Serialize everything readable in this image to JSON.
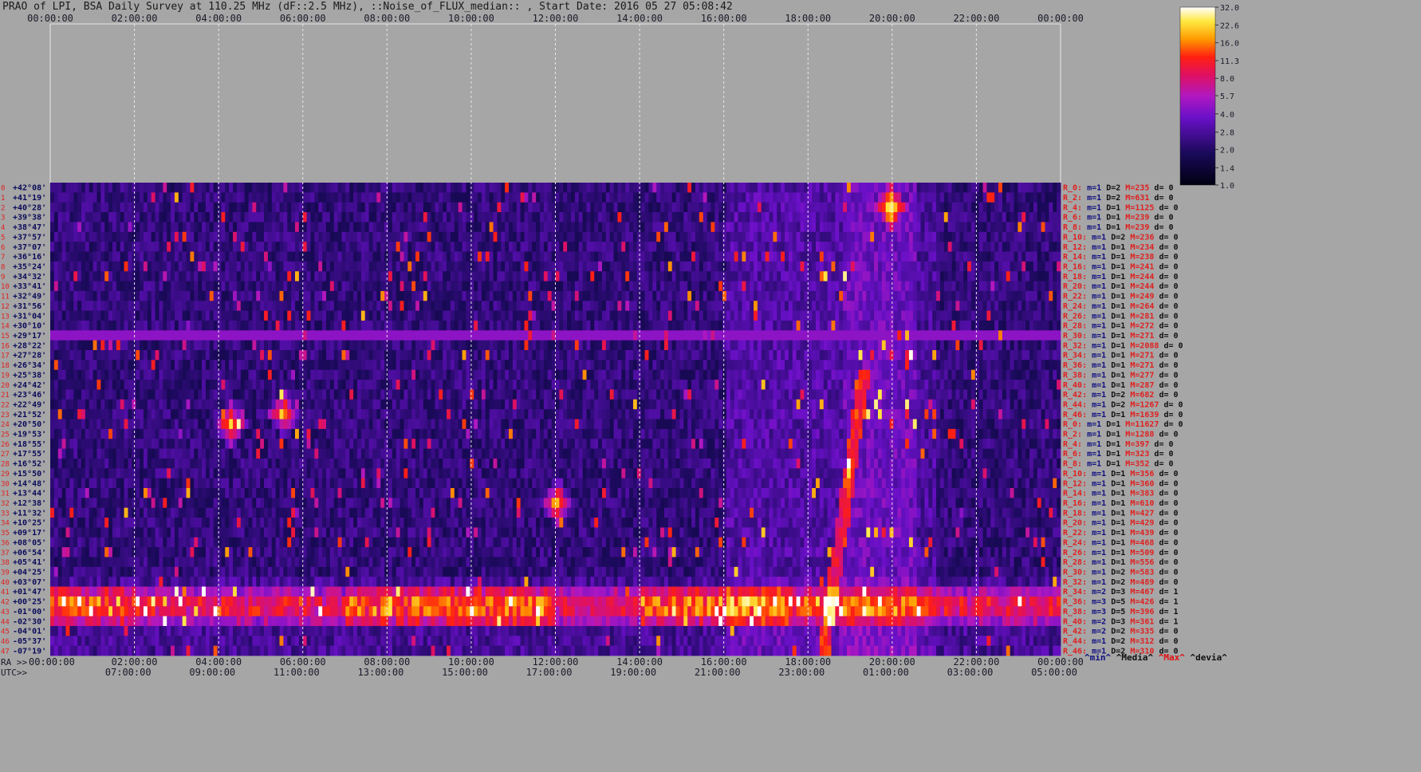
{
  "title": "PRAO of LPI, BSA Daily Survey at 110.25 MHz (dF::2.5 MHz), ::Noise_of_FLUX_median:: , Start Date: 2016 05 27 05:08:42",
  "chart_data": {
    "type": "heatmap",
    "title": "PRAO of LPI, BSA Daily Survey at 110.25 MHz (dF::2.5 MHz), ::Noise_of_FLUX_median:: , Start Date: 2016 05 27 05:08:42",
    "top_axis_ticks": [
      "00:00:00",
      "02:00:00",
      "04:00:00",
      "06:00:00",
      "08:00:00",
      "10:00:00",
      "12:00:00",
      "14:00:00",
      "16:00:00",
      "18:00:00",
      "20:00:00",
      "22:00:00",
      "00:00:00"
    ],
    "ra_axis_label": "RA >>",
    "ra_ticks": [
      "00:00:00",
      "02:00:00",
      "04:00:00",
      "06:00:00",
      "08:00:00",
      "10:00:00",
      "12:00:00",
      "14:00:00",
      "16:00:00",
      "18:00:00",
      "20:00:00",
      "22:00:00",
      "00:00:00"
    ],
    "utc_axis_label": "UTC>>",
    "utc_ticks": [
      "07:00:00",
      "09:00:00",
      "11:00:00",
      "13:00:00",
      "15:00:00",
      "17:00:00",
      "19:00:00",
      "21:00:00",
      "23:00:00",
      "01:00:00",
      "03:00:00",
      "05:00:00"
    ],
    "declinations": [
      "+42°08'",
      "+41°19'",
      "+40°28'",
      "+39°38'",
      "+38°47'",
      "+37°57'",
      "+37°07'",
      "+36°16'",
      "+35°24'",
      "+34°32'",
      "+33°41'",
      "+32°49'",
      "+31°56'",
      "+31°04'",
      "+30°10'",
      "+29°17'",
      "+28°22'",
      "+27°28'",
      "+26°34'",
      "+25°38'",
      "+24°42'",
      "+23°46'",
      "+22°49'",
      "+21°52'",
      "+20°50'",
      "+19°53'",
      "+18°55'",
      "+17°55'",
      "+16°52'",
      "+15°50'",
      "+14°48'",
      "+13°44'",
      "+12°38'",
      "+11°32'",
      "+10°25'",
      "+09°17'",
      "+08°05'",
      "+06°54'",
      "+05°41'",
      "+04°25'",
      "+03°07'",
      "+01°47'",
      "+00°25'",
      "-01°00'",
      "-02°30'",
      "-04°01'",
      "-05°37'",
      "-07°19'"
    ],
    "row_indices": [
      "0",
      "1",
      "2",
      "3",
      "4",
      "5",
      "6",
      "7",
      "8",
      "9",
      "10",
      "11",
      "12",
      "13",
      "14",
      "15",
      "16",
      "17",
      "18",
      "19",
      "20",
      "21",
      "22",
      "23",
      "24",
      "25",
      "26",
      "27",
      "28",
      "29",
      "30",
      "31",
      "32",
      "33",
      "34",
      "35",
      "36",
      "37",
      "38",
      "39",
      "40",
      "41",
      "42",
      "43",
      "44",
      "45",
      "46",
      "47"
    ],
    "row_stats": [
      {
        "r": "R_0:",
        "m": "m=1",
        "d": "D=2",
        "M": "M=235",
        "dv": "d= 0"
      },
      {
        "r": "R_2:",
        "m": "m=1",
        "d": "D=2",
        "M": "M=631",
        "dv": "d= 0"
      },
      {
        "r": "R_4:",
        "m": "m=1",
        "d": "D=1",
        "M": "M=1125",
        "dv": "d= 0"
      },
      {
        "r": "R_6:",
        "m": "m=1",
        "d": "D=1",
        "M": "M=239",
        "dv": "d= 0"
      },
      {
        "r": "R_8:",
        "m": "m=1",
        "d": "D=1",
        "M": "M=239",
        "dv": "d= 0"
      },
      {
        "r": "R_10:",
        "m": "m=1",
        "d": "D=2",
        "M": "M=236",
        "dv": "d= 0"
      },
      {
        "r": "R_12:",
        "m": "m=1",
        "d": "D=1",
        "M": "M=234",
        "dv": "d= 0"
      },
      {
        "r": "R_14:",
        "m": "m=1",
        "d": "D=1",
        "M": "M=238",
        "dv": "d= 0"
      },
      {
        "r": "R_16:",
        "m": "m=1",
        "d": "D=1",
        "M": "M=241",
        "dv": "d= 0"
      },
      {
        "r": "R_18:",
        "m": "m=1",
        "d": "D=1",
        "M": "M=244",
        "dv": "d= 0"
      },
      {
        "r": "R_20:",
        "m": "m=1",
        "d": "D=1",
        "M": "M=244",
        "dv": "d= 0"
      },
      {
        "r": "R_22:",
        "m": "m=1",
        "d": "D=1",
        "M": "M=249",
        "dv": "d= 0"
      },
      {
        "r": "R_24:",
        "m": "m=1",
        "d": "D=1",
        "M": "M=264",
        "dv": "d= 0"
      },
      {
        "r": "R_26:",
        "m": "m=1",
        "d": "D=1",
        "M": "M=281",
        "dv": "d= 0"
      },
      {
        "r": "R_28:",
        "m": "m=1",
        "d": "D=1",
        "M": "M=272",
        "dv": "d= 0"
      },
      {
        "r": "R_30:",
        "m": "m=1",
        "d": "D=1",
        "M": "M=271",
        "dv": "d= 0"
      },
      {
        "r": "R_32:",
        "m": "m=1",
        "d": "D=1",
        "M": "M=2088",
        "dv": "d= 0"
      },
      {
        "r": "R_34:",
        "m": "m=1",
        "d": "D=1",
        "M": "M=271",
        "dv": "d= 0"
      },
      {
        "r": "R_36:",
        "m": "m=1",
        "d": "D=1",
        "M": "M=271",
        "dv": "d= 0"
      },
      {
        "r": "R_38:",
        "m": "m=1",
        "d": "D=1",
        "M": "M=277",
        "dv": "d= 0"
      },
      {
        "r": "R_40:",
        "m": "m=1",
        "d": "D=1",
        "M": "M=287",
        "dv": "d= 0"
      },
      {
        "r": "R_42:",
        "m": "m=1",
        "d": "D=2",
        "M": "M=682",
        "dv": "d= 0"
      },
      {
        "r": "R_44:",
        "m": "m=1",
        "d": "D=2",
        "M": "M=1267",
        "dv": "d= 0"
      },
      {
        "r": "R_46:",
        "m": "m=1",
        "d": "D=1",
        "M": "M=1639",
        "dv": "d= 0"
      },
      {
        "r": "R_0:",
        "m": "m=1",
        "d": "D=1",
        "M": "M=11627",
        "dv": "d= 0"
      },
      {
        "r": "R_2:",
        "m": "m=1",
        "d": "D=1",
        "M": "M=1288",
        "dv": "d= 0"
      },
      {
        "r": "R_4:",
        "m": "m=1",
        "d": "D=1",
        "M": "M=397",
        "dv": "d= 0"
      },
      {
        "r": "R_6:",
        "m": "m=1",
        "d": "D=1",
        "M": "M=323",
        "dv": "d= 0"
      },
      {
        "r": "R_8:",
        "m": "m=1",
        "d": "D=1",
        "M": "M=352",
        "dv": "d= 0"
      },
      {
        "r": "R_10:",
        "m": "m=1",
        "d": "D=1",
        "M": "M=356",
        "dv": "d= 0"
      },
      {
        "r": "R_12:",
        "m": "m=1",
        "d": "D=1",
        "M": "M=360",
        "dv": "d= 0"
      },
      {
        "r": "R_14:",
        "m": "m=1",
        "d": "D=1",
        "M": "M=383",
        "dv": "d= 0"
      },
      {
        "r": "R_16:",
        "m": "m=1",
        "d": "D=1",
        "M": "M=610",
        "dv": "d= 0"
      },
      {
        "r": "R_18:",
        "m": "m=1",
        "d": "D=1",
        "M": "M=427",
        "dv": "d= 0"
      },
      {
        "r": "R_20:",
        "m": "m=1",
        "d": "D=1",
        "M": "M=429",
        "dv": "d= 0"
      },
      {
        "r": "R_22:",
        "m": "m=1",
        "d": "D=1",
        "M": "M=439",
        "dv": "d= 0"
      },
      {
        "r": "R_24:",
        "m": "m=1",
        "d": "D=1",
        "M": "M=468",
        "dv": "d= 0"
      },
      {
        "r": "R_26:",
        "m": "m=1",
        "d": "D=1",
        "M": "M=509",
        "dv": "d= 0"
      },
      {
        "r": "R_28:",
        "m": "m=1",
        "d": "D=1",
        "M": "M=556",
        "dv": "d= 0"
      },
      {
        "r": "R_30:",
        "m": "m=1",
        "d": "D=2",
        "M": "M=583",
        "dv": "d= 0"
      },
      {
        "r": "R_32:",
        "m": "m=1",
        "d": "D=2",
        "M": "M=489",
        "dv": "d= 0"
      },
      {
        "r": "R_34:",
        "m": "m=2",
        "d": "D=3",
        "M": "M=467",
        "dv": "d= 1"
      },
      {
        "r": "R_36:",
        "m": "m=3",
        "d": "D=5",
        "M": "M=426",
        "dv": "d= 1"
      },
      {
        "r": "R_38:",
        "m": "m=3",
        "d": "D=5",
        "M": "M=396",
        "dv": "d= 1"
      },
      {
        "r": "R_40:",
        "m": "m=2",
        "d": "D=3",
        "M": "M=361",
        "dv": "d= 1"
      },
      {
        "r": "R_42:",
        "m": "m=2",
        "d": "D=2",
        "M": "M=335",
        "dv": "d= 0"
      },
      {
        "r": "R_44:",
        "m": "m=1",
        "d": "D=2",
        "M": "M=312",
        "dv": "d= 0"
      },
      {
        "r": "R_46:",
        "m": "m=1",
        "d": "D=2",
        "M": "M=310",
        "dv": "d= 0"
      }
    ],
    "footer_legend": [
      {
        "text": "^min^",
        "color": "#101080"
      },
      {
        "text": "^Media^",
        "color": "#101010"
      },
      {
        "text": "^Max^",
        "color": "#e01010"
      },
      {
        "text": "^devia^",
        "color": "#101010"
      }
    ],
    "colorbar_ticks": [
      "32.0",
      "22.6",
      "16.0",
      "11.3",
      "8.0",
      "5.7",
      "4.0",
      "2.8",
      "2.0",
      "1.4",
      "1.0"
    ],
    "colorbar_range": [
      1.0,
      32.0
    ],
    "colorscale": "black-blue-purple-red-orange-yellow-white",
    "bright_sources": [
      {
        "ra": "04:15",
        "dec": "+20°50'"
      },
      {
        "ra": "19:55",
        "dec": "+40°28'"
      },
      {
        "ra": "05:30",
        "dec": "+21°52'"
      },
      {
        "ra": "12:00",
        "dec": "+12°38'"
      }
    ],
    "horizontal_band": {
      "dec": "+29°17'"
    },
    "equatorial_band": {
      "dec_from": "+01°47'",
      "dec_to": "-02°30'"
    }
  },
  "colors": {
    "background": "#a6a6a6",
    "row_label": "#0a0a5a",
    "row_index": "#e02020",
    "stat_r": "#e02020",
    "stat_blue": "#101080",
    "stat_dark": "#101010"
  }
}
